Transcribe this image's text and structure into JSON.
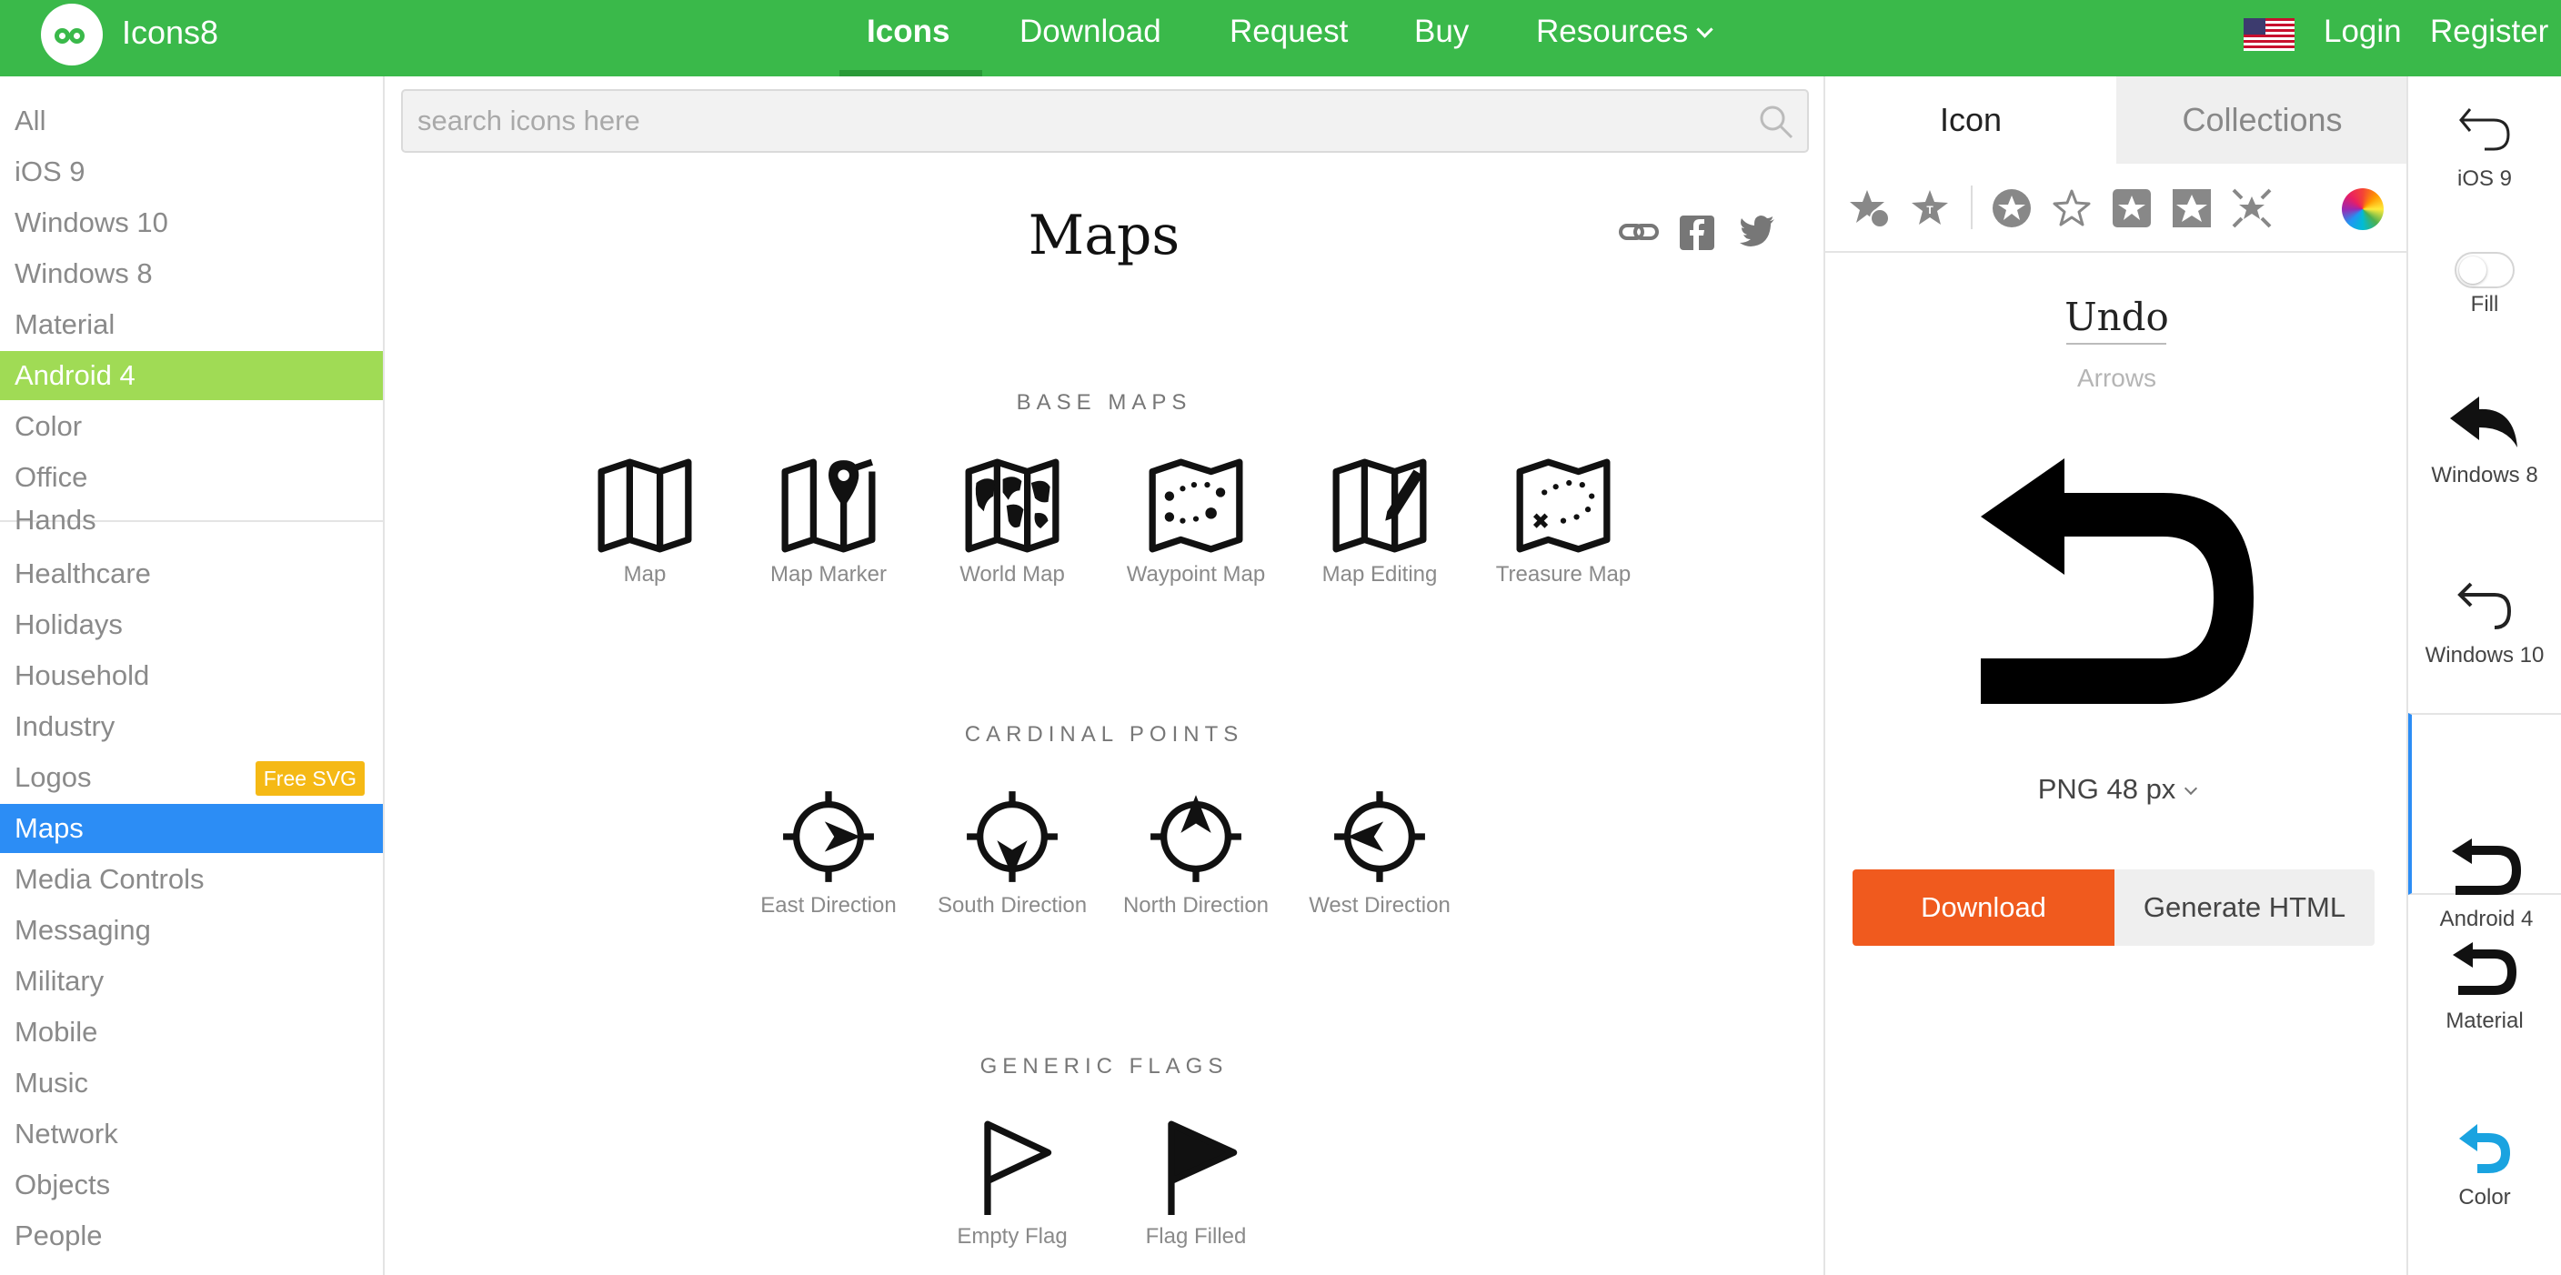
{
  "header": {
    "brand": "Icons8",
    "nav": [
      {
        "label": "Icons"
      },
      {
        "label": "Download"
      },
      {
        "label": "Request"
      },
      {
        "label": "Buy"
      },
      {
        "label": "Resources"
      }
    ],
    "login": "Login",
    "register": "Register",
    "brand_color": "#3ab94a"
  },
  "sidebar": {
    "platforms": [
      "All",
      "iOS 9",
      "Windows 10",
      "Windows 8",
      "Material",
      "Android 4",
      "Color",
      "Office"
    ],
    "selected_platform": "Android 4",
    "categories": [
      "Hands",
      "Healthcare",
      "Holidays",
      "Household",
      "Industry",
      "Logos",
      "Maps",
      "Media Controls",
      "Messaging",
      "Military",
      "Mobile",
      "Music",
      "Network",
      "Objects",
      "People"
    ],
    "selected_category": "Maps",
    "logos_badge": "Free SVG"
  },
  "search": {
    "placeholder": "search icons here"
  },
  "page": {
    "title": "Maps",
    "sections": [
      {
        "title": "BASE MAPS",
        "icons": [
          "Map",
          "Map Marker",
          "World Map",
          "Waypoint Map",
          "Map Editing",
          "Treasure Map"
        ]
      },
      {
        "title": "CARDINAL POINTS",
        "icons": [
          "East Direction",
          "South Direction",
          "North Direction",
          "West Direction"
        ]
      },
      {
        "title": "GENERIC FLAGS",
        "icons": [
          "Empty Flag",
          "Flag Filled"
        ]
      }
    ]
  },
  "detail": {
    "tabs": [
      "Icon",
      "Collections"
    ],
    "icon_name": "Undo",
    "icon_category": "Arrows",
    "format": "PNG 48 px",
    "download_label": "Download",
    "generate_label": "Generate HTML",
    "download_color": "#f05a1e"
  },
  "variants": {
    "items": [
      "iOS 9",
      "Fill",
      "Windows 8",
      "Windows 10",
      "Android 4",
      "Material",
      "Color"
    ],
    "selected": "Android 4",
    "accent": "#2c8df5",
    "color_variant_tint": "#1aa3e0"
  }
}
